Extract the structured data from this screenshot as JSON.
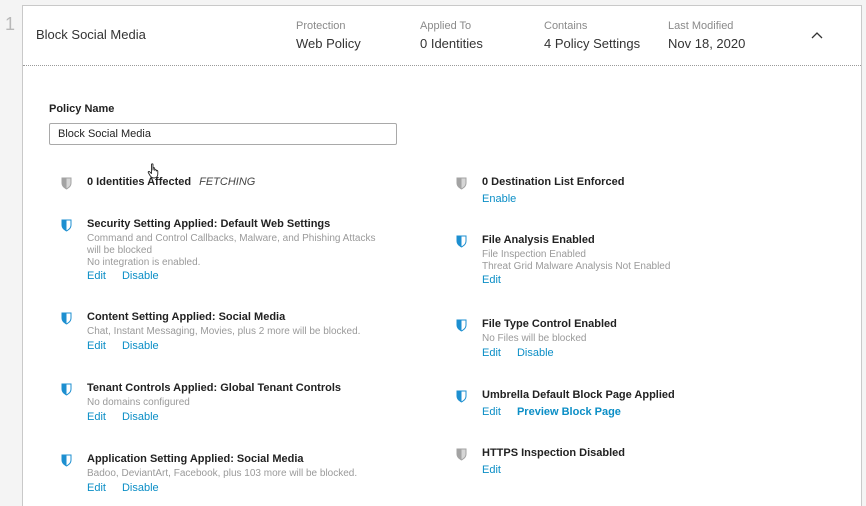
{
  "row_number": "1",
  "policy": {
    "title": "Block Social Media",
    "meta": [
      {
        "label": "Protection",
        "value": "Web Policy"
      },
      {
        "label": "Applied To",
        "value": "0 Identities"
      },
      {
        "label": "Contains",
        "value": "4 Policy Settings"
      },
      {
        "label": "Last Modified",
        "value": "Nov 18, 2020"
      }
    ],
    "collapse_icon": "chevron-up-icon"
  },
  "form": {
    "policy_name_label": "Policy Name",
    "policy_name_value": "Block Social Media"
  },
  "colors": {
    "accent": "#0b8ec6",
    "shield_blue": "#1d8fd0",
    "shield_gray": "#9b9b9b"
  },
  "left_items": [
    {
      "title": "0 Identities Affected",
      "status": "FETCHING",
      "icon": "shield-gray-icon"
    },
    {
      "title": "Security Setting Applied: Default Web Settings",
      "desc1": "Command and Control Callbacks, Malware, and Phishing Attacks",
      "desc2": "will be blocked",
      "desc3": "No integration is enabled.",
      "link1": "Edit",
      "link2": "Disable",
      "icon": "shield-blue-icon"
    },
    {
      "title": "Content Setting Applied: Social Media",
      "desc1": "Chat, Instant Messaging, Movies, plus 2 more will be blocked.",
      "link1": "Edit",
      "link2": "Disable",
      "icon": "shield-blue-icon"
    },
    {
      "title": "Tenant Controls Applied: Global Tenant Controls",
      "desc1": "No domains configured",
      "link1": "Edit",
      "link2": "Disable",
      "icon": "shield-blue-icon"
    },
    {
      "title": "Application Setting Applied: Social Media",
      "desc1": "Badoo, DeviantArt, Facebook, plus 103 more will be blocked.",
      "link1": "Edit",
      "link2": "Disable",
      "icon": "shield-blue-icon"
    }
  ],
  "right_items": [
    {
      "title": "0 Destination List Enforced",
      "link1": "Enable",
      "icon": "shield-gray-icon"
    },
    {
      "title": "File Analysis Enabled",
      "desc1": "File Inspection Enabled",
      "desc2": "Threat Grid Malware Analysis Not Enabled",
      "link1": "Edit",
      "icon": "shield-blue-icon"
    },
    {
      "title": "File Type Control Enabled",
      "desc1": "No Files will be blocked",
      "link1": "Edit",
      "link2": "Disable",
      "icon": "shield-blue-icon"
    },
    {
      "title": "Umbrella Default Block Page Applied",
      "link1": "Edit",
      "link2": "Preview Block Page",
      "icon": "shield-blue-icon"
    },
    {
      "title": "HTTPS Inspection Disabled",
      "link1": "Edit",
      "icon": "shield-gray-icon"
    }
  ]
}
